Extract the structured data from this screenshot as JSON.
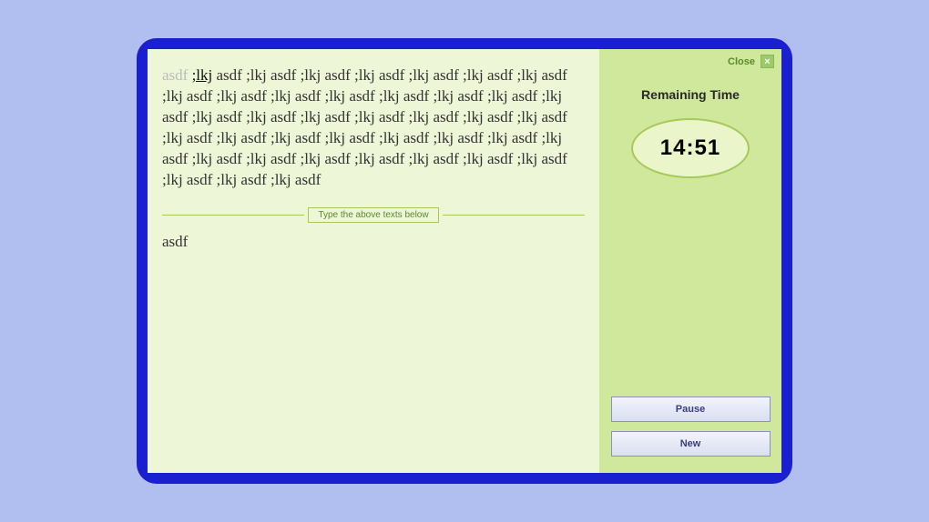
{
  "close": {
    "label": "Close",
    "x": "×"
  },
  "timer": {
    "title": "Remaining Time",
    "value": "14:51"
  },
  "buttons": {
    "pause": "Pause",
    "new": "New"
  },
  "prompt": {
    "typed": "asdf ",
    "current": ";lkj",
    "rest": " asdf ;lkj asdf ;lkj asdf ;lkj asdf ;lkj asdf ;lkj asdf ;lkj asdf ;lkj asdf ;lkj asdf ;lkj asdf ;lkj asdf ;lkj asdf ;lkj asdf ;lkj asdf ;lkj asdf ;lkj asdf ;lkj asdf ;lkj asdf ;lkj asdf ;lkj asdf ;lkj asdf ;lkj asdf ;lkj asdf ;lkj asdf ;lkj asdf ;lkj asdf ;lkj asdf ;lkj asdf ;lkj asdf ;lkj asdf ;lkj asdf ;lkj asdf ;lkj asdf ;lkj asdf ;lkj asdf ;lkj asdf ;lkj asdf ;lkj asdf ;lkj asdf ;lkj asdf"
  },
  "divider_label": "Type the above texts below",
  "input_value": "asdf"
}
